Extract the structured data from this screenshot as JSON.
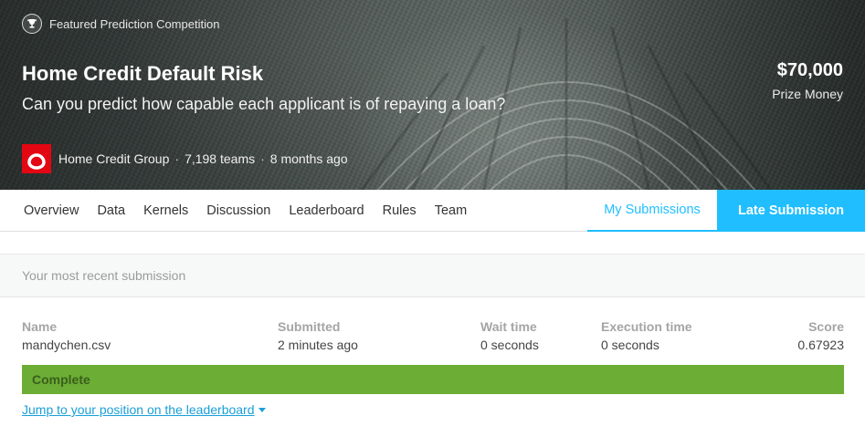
{
  "hero": {
    "featured_label": "Featured Prediction Competition",
    "title": "Home Credit Default Risk",
    "subtitle": "Can you predict how capable each applicant is of repaying a loan?",
    "prize_amount": "$70,000",
    "prize_label": "Prize Money",
    "host_name": "Home Credit Group",
    "teams": "7,198 teams",
    "age": "8 months ago",
    "separator": "·"
  },
  "nav": {
    "tabs": [
      "Overview",
      "Data",
      "Kernels",
      "Discussion",
      "Leaderboard",
      "Rules",
      "Team"
    ],
    "my_submissions": "My Submissions",
    "late_submission": "Late Submission"
  },
  "submission": {
    "header": "Your most recent submission",
    "columns": {
      "name": {
        "label": "Name",
        "value": "mandychen.csv"
      },
      "submitted": {
        "label": "Submitted",
        "value": "2 minutes ago"
      },
      "wait": {
        "label": "Wait time",
        "value": "0 seconds"
      },
      "execution": {
        "label": "Execution time",
        "value": "0 seconds"
      },
      "score": {
        "label": "Score",
        "value": "0.67923"
      }
    },
    "status": "Complete",
    "jump_link": "Jump to your position on the leaderboard"
  },
  "colors": {
    "accent": "#20beff",
    "complete": "#6cad35",
    "host_brand": "#e30613"
  },
  "icons": {
    "featured": "trophy-icon",
    "host": "home-credit-logo",
    "jump": "caret-down-icon"
  }
}
